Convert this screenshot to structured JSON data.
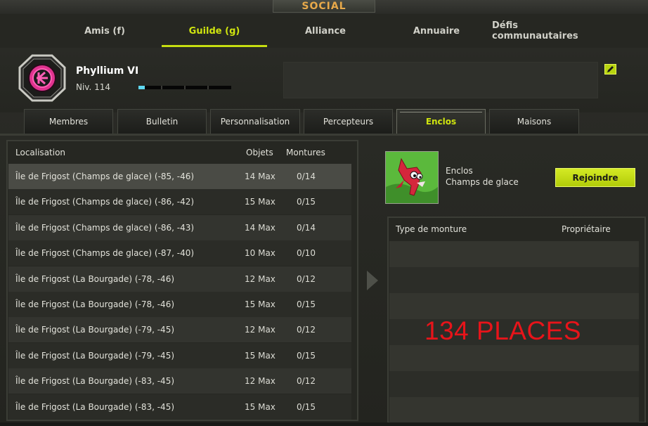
{
  "window": {
    "title": "SOCIAL"
  },
  "top_tabs": [
    {
      "label": "Amis (f)",
      "active": false
    },
    {
      "label": "Guilde (g)",
      "active": true
    },
    {
      "label": "Alliance",
      "active": false
    },
    {
      "label": "Annuaire",
      "active": false
    },
    {
      "label": "Défis communautaires",
      "active": false
    }
  ],
  "guild": {
    "name": "Phyllium VI",
    "level": "Niv. 114",
    "xp_progress": 0.07,
    "emblem_icon": "guild-emblem-icon",
    "message": ""
  },
  "sub_tabs": [
    {
      "label": "Membres",
      "active": false
    },
    {
      "label": "Bulletin",
      "active": false
    },
    {
      "label": "Personnalisation",
      "active": false
    },
    {
      "label": "Percepteurs",
      "active": false
    },
    {
      "label": "Enclos",
      "active": true
    },
    {
      "label": "Maisons",
      "active": false
    }
  ],
  "enclos_list": {
    "columns": [
      "Localisation",
      "Objets",
      "Montures"
    ],
    "rows": [
      {
        "location": "Île de Frigost (Champs de glace) (-85, -46)",
        "objects": "14 Max",
        "mounts": "0/14",
        "selected": true
      },
      {
        "location": "Île de Frigost (Champs de glace) (-86, -42)",
        "objects": "15 Max",
        "mounts": "0/15"
      },
      {
        "location": "Île de Frigost (Champs de glace) (-86, -43)",
        "objects": "14 Max",
        "mounts": "0/14"
      },
      {
        "location": "Île de Frigost (Champs de glace) (-87, -40)",
        "objects": "10 Max",
        "mounts": "0/10"
      },
      {
        "location": "Île de Frigost (La Bourgade) (-78, -46)",
        "objects": "12 Max",
        "mounts": "0/12"
      },
      {
        "location": "Île de Frigost (La Bourgade) (-78, -46)",
        "objects": "15 Max",
        "mounts": "0/15"
      },
      {
        "location": "Île de Frigost (La Bourgade) (-79, -45)",
        "objects": "12 Max",
        "mounts": "0/12"
      },
      {
        "location": "Île de Frigost (La Bourgade) (-79, -45)",
        "objects": "15 Max",
        "mounts": "0/15"
      },
      {
        "location": "Île de Frigost (La Bourgade) (-83, -45)",
        "objects": "12 Max",
        "mounts": "0/12"
      },
      {
        "location": "Île de Frigost (La Bourgade) (-83, -45)",
        "objects": "15 Max",
        "mounts": "0/15"
      }
    ]
  },
  "detail": {
    "label": "Enclos",
    "area": "Champs de glace",
    "join_label": "Rejoindre",
    "mount_columns": [
      "Type de monture",
      "Propriétaire"
    ],
    "overlay_text": "134 PLACES"
  },
  "colors": {
    "accent": "#c6dd10",
    "title": "#e8a94a",
    "overlay": "#e8141a",
    "xp": "#5fd8f0"
  }
}
